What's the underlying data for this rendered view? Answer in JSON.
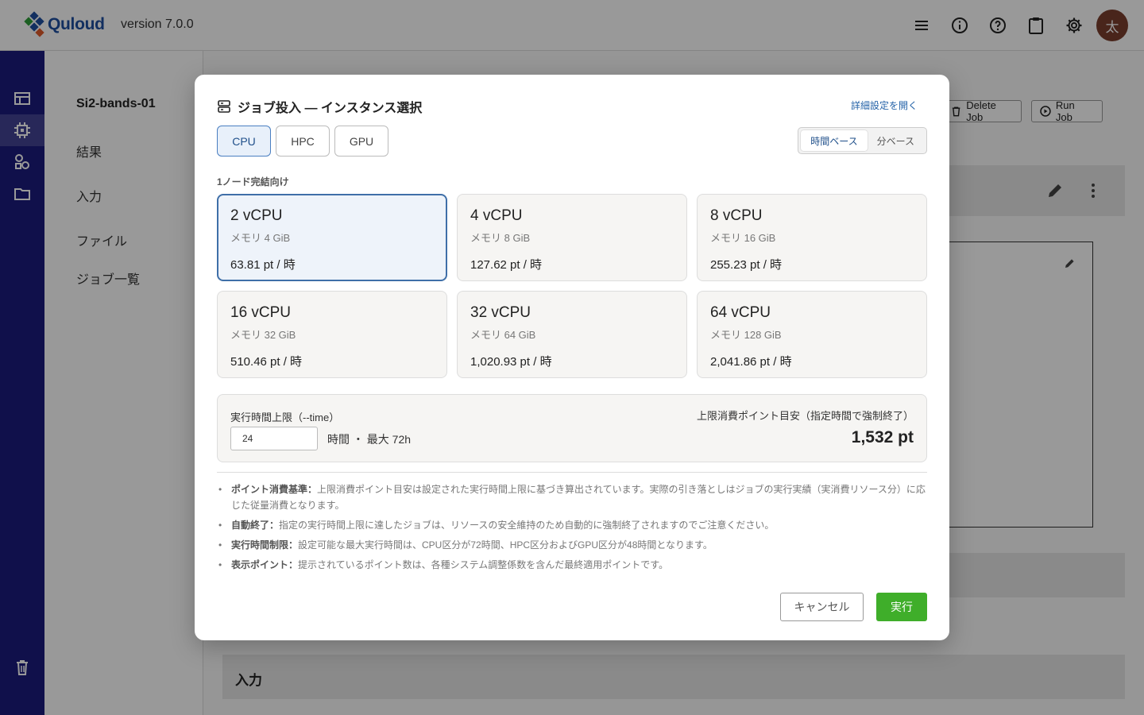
{
  "app": {
    "name": "Quloud",
    "version": "version 7.0.0",
    "avatar_initial": "太"
  },
  "topbar_icons": [
    "menu-icon",
    "info-icon",
    "help-icon",
    "clipboard-icon",
    "gear-icon"
  ],
  "rail_icons": [
    "table-icon",
    "chip-icon",
    "nodes-icon",
    "folder-icon",
    "trash-icon"
  ],
  "sidebar": {
    "title": "Si2-bands-01",
    "items": [
      {
        "label": "結果"
      },
      {
        "label": "入力"
      },
      {
        "label": "ファイル"
      },
      {
        "label": "ジョブ一覧"
      }
    ]
  },
  "main": {
    "delete_job": "Delete Job",
    "run_job": "Run Job",
    "input_panel_title": "入力"
  },
  "modal": {
    "title": "ジョブ投入 — インスタンス選択",
    "advanced_link": "詳細設定を開く",
    "types": [
      {
        "label": "CPU",
        "active": true
      },
      {
        "label": "HPC",
        "active": false
      },
      {
        "label": "GPU",
        "active": false
      }
    ],
    "basis": [
      {
        "label": "時間ベース",
        "active": true
      },
      {
        "label": "分ベース",
        "active": false
      }
    ],
    "section_label": "1ノード完結向け",
    "instances": [
      {
        "name": "2 vCPU",
        "memory": "メモリ 4 GiB",
        "price": "63.81 pt / 時",
        "selected": true
      },
      {
        "name": "4 vCPU",
        "memory": "メモリ 8 GiB",
        "price": "127.62 pt / 時",
        "selected": false
      },
      {
        "name": "8 vCPU",
        "memory": "メモリ 16 GiB",
        "price": "255.23 pt / 時",
        "selected": false
      },
      {
        "name": "16 vCPU",
        "memory": "メモリ 32 GiB",
        "price": "510.46 pt / 時",
        "selected": false
      },
      {
        "name": "32 vCPU",
        "memory": "メモリ 64 GiB",
        "price": "1,020.93 pt / 時",
        "selected": false
      },
      {
        "name": "64 vCPU",
        "memory": "メモリ 128 GiB",
        "price": "2,041.86 pt / 時",
        "selected": false
      }
    ],
    "time_limit": {
      "label": "実行時間上限（--time）",
      "value": "24",
      "unit": "時間 ・ 最大 72h",
      "estimate_label": "上限消費ポイント目安（指定時間で強制終了）",
      "estimate_value": "1,532 pt"
    },
    "notes": [
      {
        "title": "ポイント消費基準：",
        "text": "上限消費ポイント目安は設定された実行時間上限に基づき算出されています。実際の引き落としはジョブの実行実績（実消費リソース分）に応じた従量消費となります。"
      },
      {
        "title": "自動終了：",
        "text": "指定の実行時間上限に達したジョブは、リソースの安全維持のため自動的に強制終了されますのでご注意ください。"
      },
      {
        "title": "実行時間制限：",
        "text": "設定可能な最大実行時間は、CPU区分が72時間、HPC区分およびGPU区分が48時間となります。"
      },
      {
        "title": "表示ポイント：",
        "text": "提示されているポイント数は、各種システム調整係数を含んだ最終適用ポイントです。"
      }
    ],
    "cancel_label": "キャンセル",
    "run_label": "実行"
  }
}
